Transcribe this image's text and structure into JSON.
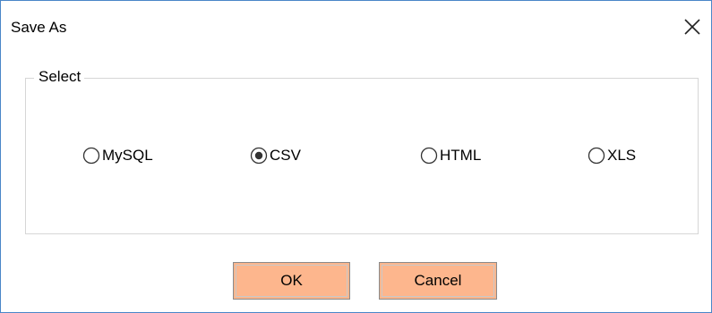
{
  "window": {
    "title": "Save As",
    "close_icon": "close-icon"
  },
  "group": {
    "legend": "Select",
    "options": [
      {
        "label": "MySQL",
        "selected": false
      },
      {
        "label": "CSV",
        "selected": true
      },
      {
        "label": "HTML",
        "selected": false
      },
      {
        "label": "XLS",
        "selected": false
      }
    ]
  },
  "buttons": {
    "ok_label": "OK",
    "cancel_label": "Cancel"
  },
  "colors": {
    "button_fill": "#fdb68d",
    "window_border": "#4a86c8",
    "group_border": "#d6d6d6"
  }
}
